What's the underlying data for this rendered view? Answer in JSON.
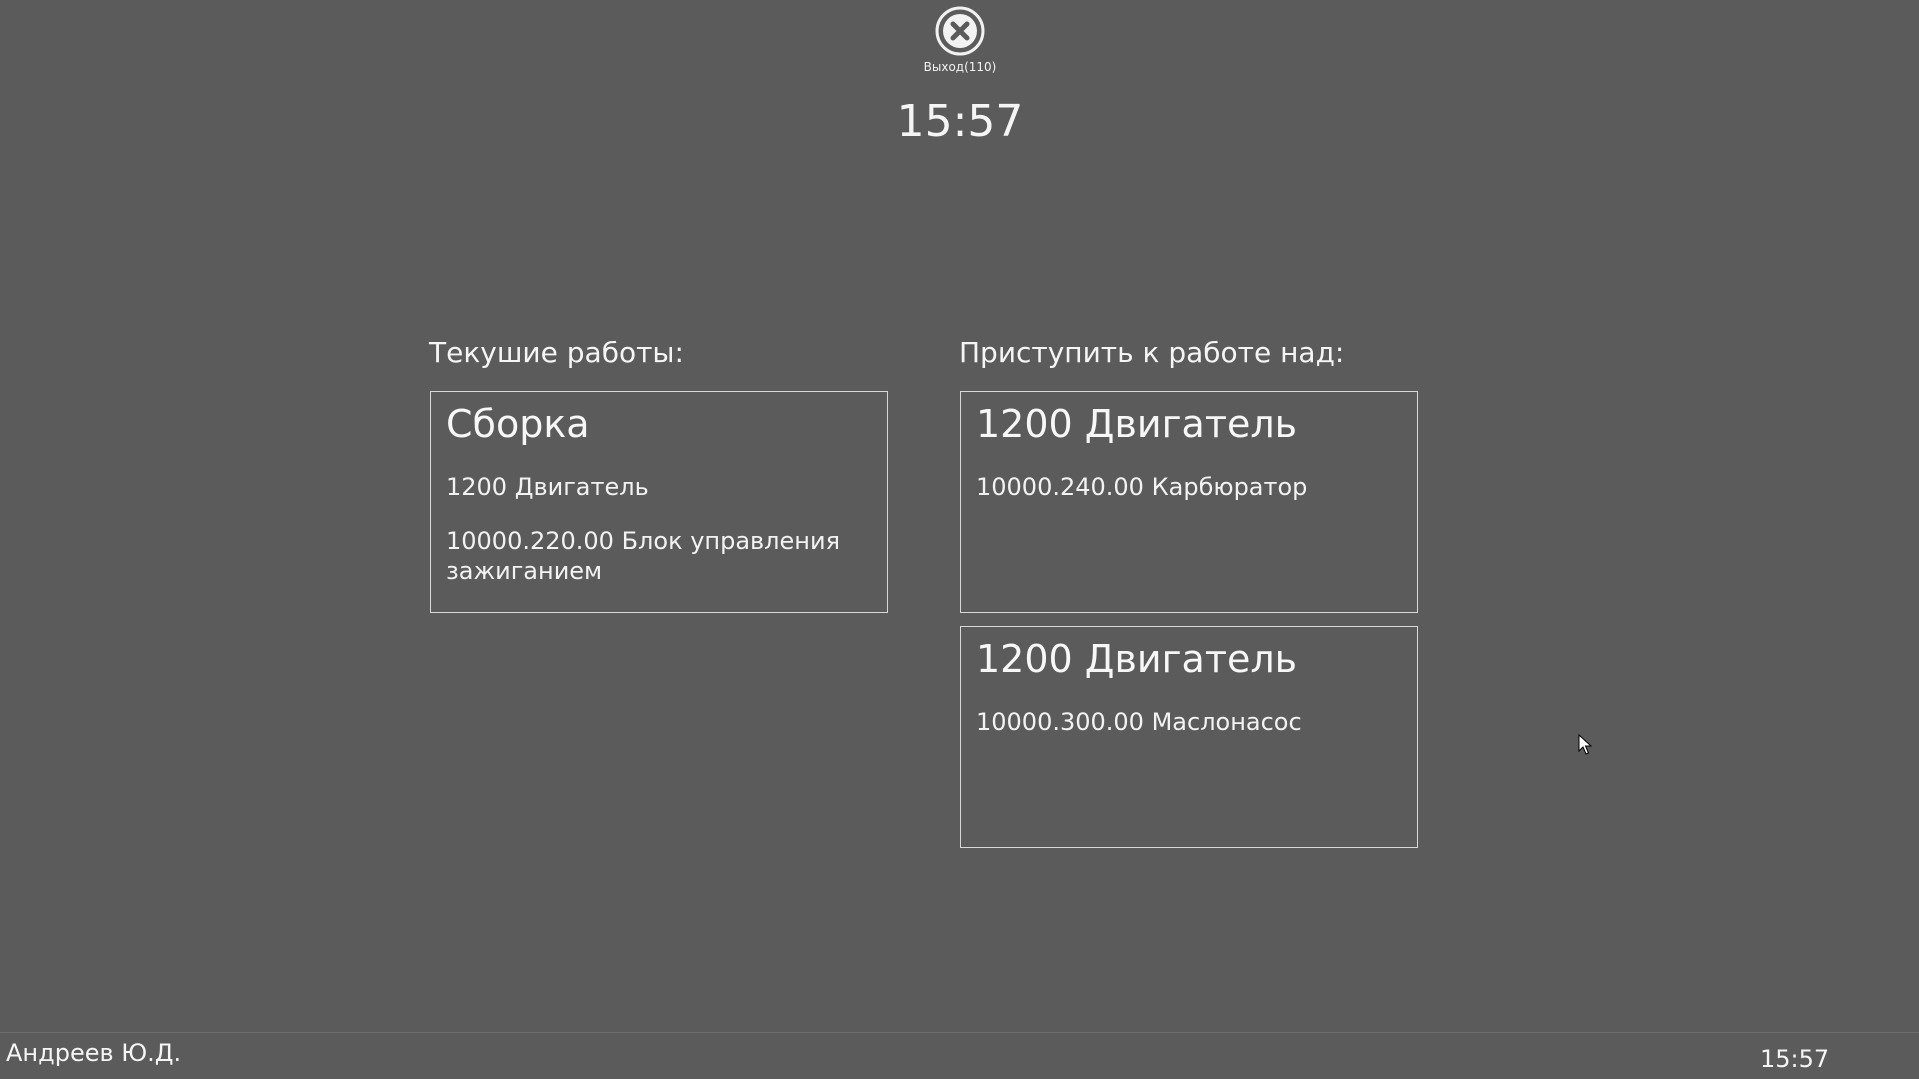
{
  "header": {
    "exit_label": "Выход(110)",
    "clock": "15:57"
  },
  "current_work": {
    "heading": "Текушие работы:",
    "cards": [
      {
        "title": "Сборка",
        "lines": [
          "1200 Двигатель",
          "10000.220.00 Блок управления зажиганием"
        ]
      }
    ]
  },
  "start_work": {
    "heading": "Приступить к работе над:",
    "cards": [
      {
        "title": "1200 Двигатель",
        "lines": [
          "10000.240.00 Карбюратор"
        ]
      },
      {
        "title": "1200 Двигатель",
        "lines": [
          "10000.300.00 Маслонасос"
        ]
      }
    ]
  },
  "statusbar": {
    "user": "Андреев Ю.Д.",
    "time": "15:57"
  },
  "icons": {
    "exit": "close-circle-icon",
    "cursor": "mouse-pointer-icon"
  },
  "colors": {
    "background": "#5b5b5b",
    "text": "#ffffff",
    "card_border": "#d8d8d8"
  }
}
